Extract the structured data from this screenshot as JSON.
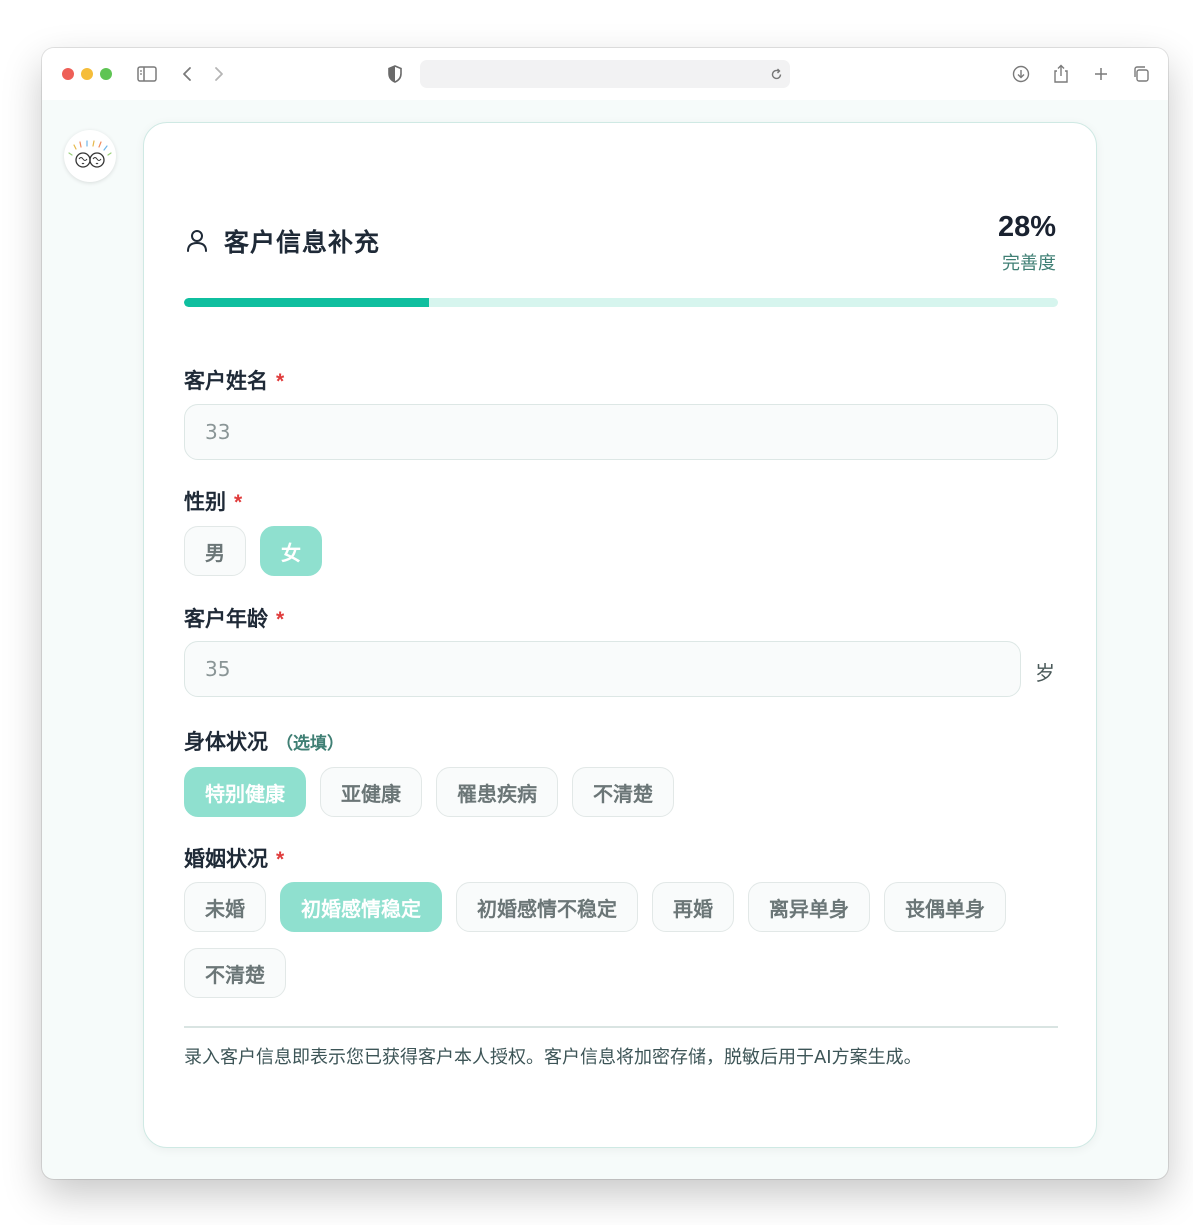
{
  "browser": {
    "icons": [
      "sidebar-icon",
      "back-icon",
      "forward-icon",
      "shield-icon",
      "reload-icon",
      "download-icon",
      "share-icon",
      "new-tab-icon",
      "tabs-icon"
    ],
    "address": ""
  },
  "header": {
    "title": "客户信息补充",
    "completion_value": "28%",
    "completion_label": "完善度",
    "progress_fraction": 0.28
  },
  "form": {
    "name": {
      "label": "客户姓名",
      "required": "*",
      "value": "33"
    },
    "gender": {
      "label": "性别",
      "required": "*",
      "options": [
        "男",
        "女"
      ],
      "selected": "女"
    },
    "age": {
      "label": "客户年龄",
      "required": "*",
      "value": "35",
      "unit": "岁"
    },
    "health": {
      "label": "身体状况",
      "optional": "（选填）",
      "options": [
        "特别健康",
        "亚健康",
        "罹患疾病",
        "不清楚"
      ],
      "selected": "特别健康"
    },
    "marital": {
      "label": "婚姻状况",
      "required": "*",
      "options": [
        "未婚",
        "初婚感情稳定",
        "初婚感情不稳定",
        "再婚",
        "离异单身",
        "丧偶单身",
        "不清楚"
      ],
      "selected": "初婚感情稳定"
    }
  },
  "notice": "录入客户信息即表示您已获得客户本人授权。客户信息将加密存储，脱敏后用于AI方案生成。",
  "colors": {
    "accent": "#0fbf9f",
    "chip_active": "#8fe0cf",
    "required": "#e03b3b"
  }
}
